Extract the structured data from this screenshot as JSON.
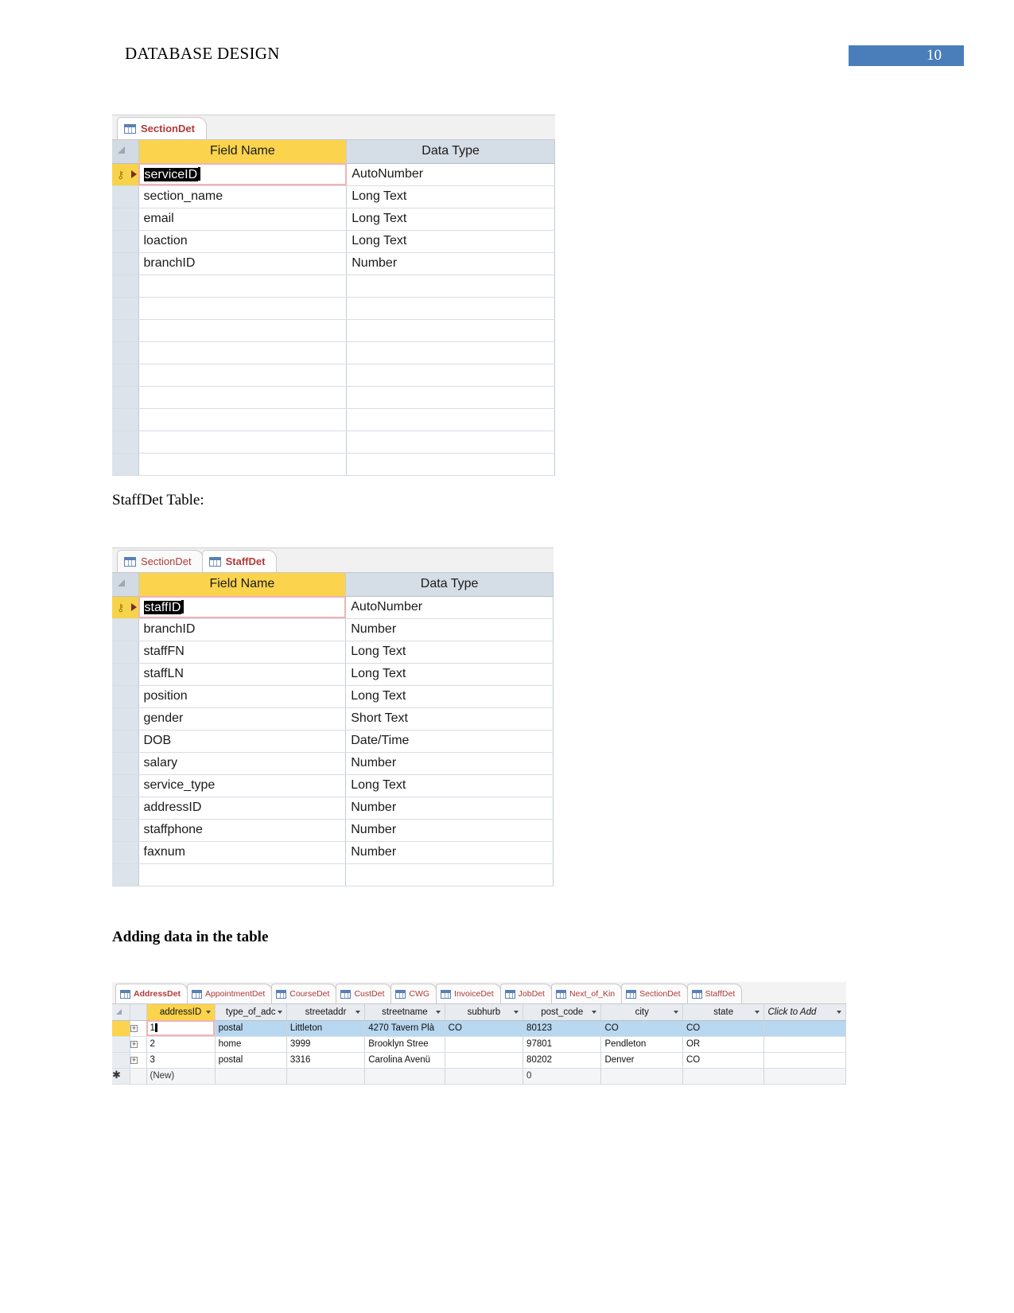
{
  "header": {
    "doc_title": "DATABASE DESIGN",
    "page_number": "10"
  },
  "section_det_window": {
    "tabs": [
      {
        "label": "SectionDet",
        "active": true,
        "icon": "table-icon"
      }
    ],
    "columns": {
      "field_name": "Field Name",
      "data_type": "Data Type"
    },
    "rows": [
      {
        "field": "serviceID",
        "type": "AutoNumber",
        "primary_key": true,
        "selected": true
      },
      {
        "field": "section_name",
        "type": "Long Text",
        "primary_key": false,
        "selected": false
      },
      {
        "field": "email",
        "type": "Long Text",
        "primary_key": false,
        "selected": false
      },
      {
        "field": "loaction",
        "type": "Long Text",
        "primary_key": false,
        "selected": false
      },
      {
        "field": "branchID",
        "type": "Number",
        "primary_key": false,
        "selected": false
      }
    ],
    "empty_row_count": 9
  },
  "staff_heading": "StaffDet Table:",
  "staff_det_window": {
    "tabs": [
      {
        "label": "SectionDet",
        "active": false,
        "icon": "table-icon"
      },
      {
        "label": "StaffDet",
        "active": true,
        "icon": "table-icon"
      }
    ],
    "columns": {
      "field_name": "Field Name",
      "data_type": "Data Type"
    },
    "rows": [
      {
        "field": "staffID",
        "type": "AutoNumber",
        "primary_key": true,
        "selected": true
      },
      {
        "field": "branchID",
        "type": "Number",
        "primary_key": false,
        "selected": false
      },
      {
        "field": "staffFN",
        "type": "Long Text",
        "primary_key": false,
        "selected": false
      },
      {
        "field": "staffLN",
        "type": "Long Text",
        "primary_key": false,
        "selected": false
      },
      {
        "field": "position",
        "type": "Long Text",
        "primary_key": false,
        "selected": false
      },
      {
        "field": "gender",
        "type": "Short Text",
        "primary_key": false,
        "selected": false
      },
      {
        "field": "DOB",
        "type": "Date/Time",
        "primary_key": false,
        "selected": false
      },
      {
        "field": "salary",
        "type": "Number",
        "primary_key": false,
        "selected": false
      },
      {
        "field": "service_type",
        "type": "Long Text",
        "primary_key": false,
        "selected": false
      },
      {
        "field": "addressID",
        "type": "Number",
        "primary_key": false,
        "selected": false
      },
      {
        "field": "staffphone",
        "type": "Number",
        "primary_key": false,
        "selected": false
      },
      {
        "field": "faxnum",
        "type": "Number",
        "primary_key": false,
        "selected": false
      }
    ],
    "empty_row_count": 1
  },
  "adding_data_heading": "Adding data in the table",
  "datasheet_window": {
    "tabs": [
      {
        "label": "AddressDet",
        "active": true,
        "icon": "table-icon"
      },
      {
        "label": "AppointmentDet",
        "active": false,
        "icon": "table-icon"
      },
      {
        "label": "CourseDet",
        "active": false,
        "icon": "table-icon"
      },
      {
        "label": "CustDet",
        "active": false,
        "icon": "table-icon"
      },
      {
        "label": "CWG",
        "active": false,
        "icon": "table-icon"
      },
      {
        "label": "InvoiceDet",
        "active": false,
        "icon": "table-icon"
      },
      {
        "label": "JobDet",
        "active": false,
        "icon": "table-icon"
      },
      {
        "label": "Next_of_Kin",
        "active": false,
        "icon": "table-icon"
      },
      {
        "label": "SectionDet",
        "active": false,
        "icon": "table-icon"
      },
      {
        "label": "StaffDet",
        "active": false,
        "icon": "table-icon"
      }
    ],
    "columns": [
      "addressID",
      "type_of_adc",
      "streetaddr",
      "streetname",
      "subhurb",
      "post_code",
      "city",
      "state",
      "Click to Add"
    ],
    "rows": [
      {
        "selected": true,
        "addressID": "1",
        "type_of_adc": "postal",
        "streetaddr": "Littleton",
        "streetname": "4270 Tavern Plà",
        "subhurb": "CO",
        "post_code": "80123",
        "city": "CO",
        "state": "CO"
      },
      {
        "selected": false,
        "addressID": "2",
        "type_of_adc": "home",
        "streetaddr": "3999",
        "streetname": "Brooklyn Stree",
        "subhurb": "",
        "post_code": "97801",
        "city": "Pendleton",
        "state": "OR"
      },
      {
        "selected": false,
        "addressID": "3",
        "type_of_adc": "postal",
        "streetaddr": "3316",
        "streetname": "Carolina Avenü",
        "subhurb": "",
        "post_code": "80202",
        "city": "Denver",
        "state": "CO"
      }
    ],
    "new_row": {
      "addressID": "(New)",
      "post_code": "0"
    }
  },
  "colors": {
    "accent_badge": "#4a7ebb",
    "field_header": "#fbd34d",
    "type_header": "#d5dde6",
    "tab_text": "#b03a3a",
    "row_selection": "#b8d7f0"
  }
}
